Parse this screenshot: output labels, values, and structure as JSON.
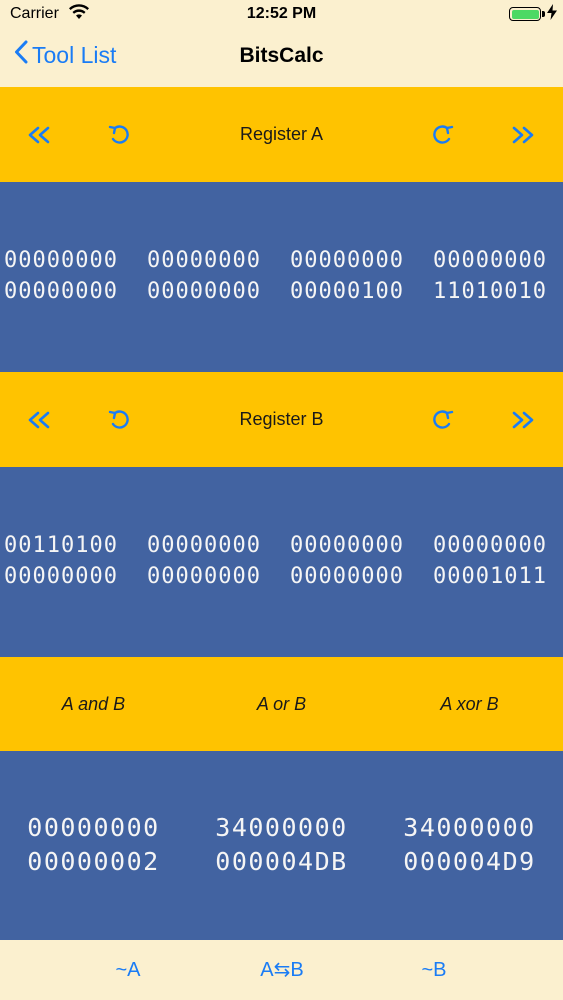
{
  "status": {
    "carrier": "Carrier",
    "time": "12:52 PM"
  },
  "nav": {
    "back_label": "Tool List",
    "title": "BitsCalc"
  },
  "register_a": {
    "title": "Register A",
    "row1": [
      "00000000",
      "00000000",
      "00000000",
      "00000000"
    ],
    "row2": [
      "00000000",
      "00000000",
      "00000100",
      "11010010"
    ]
  },
  "register_b": {
    "title": "Register B",
    "row1": [
      "00110100",
      "00000000",
      "00000000",
      "00000000"
    ],
    "row2": [
      "00000000",
      "00000000",
      "00000000",
      "00001011"
    ]
  },
  "ops": {
    "and_label": "A and B",
    "or_label": "A or B",
    "xor_label": "A xor B"
  },
  "results": {
    "and": [
      "00000000",
      "00000002"
    ],
    "or": [
      "34000000",
      "000004DB"
    ],
    "xor": [
      "34000000",
      "000004D9"
    ]
  },
  "bottom": {
    "not_a": "~A",
    "swap": "A⇆B",
    "not_b": "~B"
  },
  "colors": {
    "accent": "#1A7CF5",
    "yellow": "#FFC300",
    "panel": "#4263A1",
    "background": "#FBF0CF"
  }
}
